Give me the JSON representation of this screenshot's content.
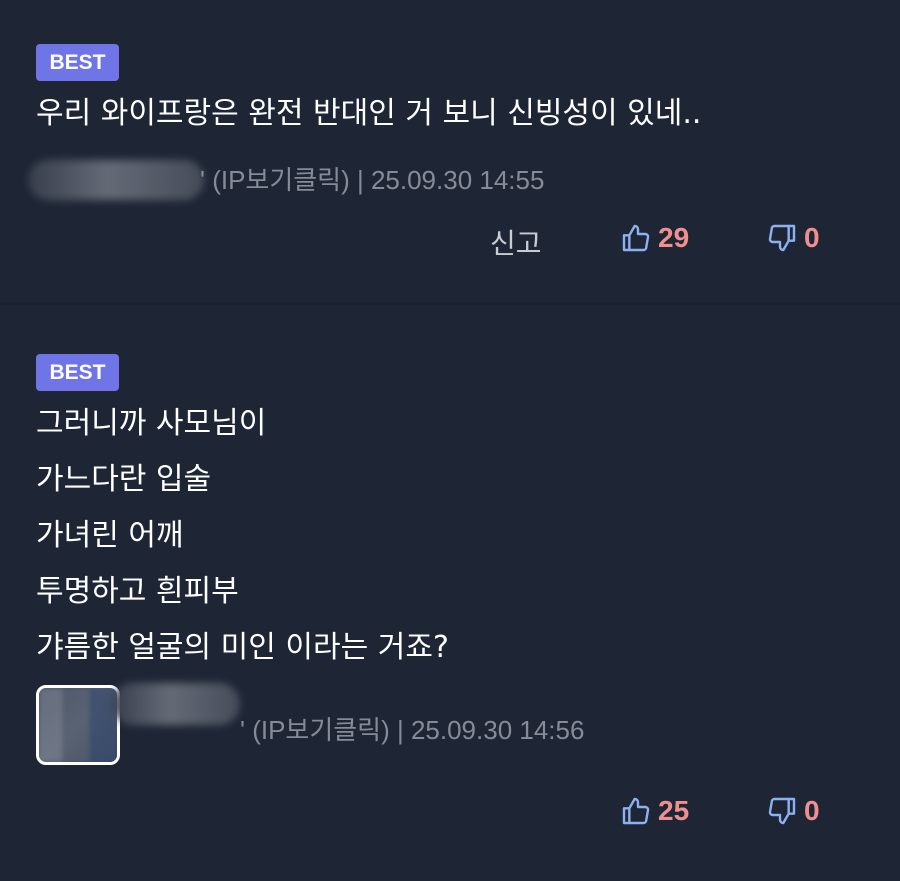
{
  "comments": [
    {
      "badge": "BEST",
      "lines": [
        "우리 와이프랑은 완전 반대인 거 보니 신빙성이 있네.."
      ],
      "meta": "' (IP보기클릭) | 25.09.30 14:55",
      "report_label": "신고",
      "likes": "29",
      "dislikes": "0",
      "icons": {
        "like": "thumbs-up-icon",
        "dislike": "thumbs-down-icon"
      }
    },
    {
      "badge": "BEST",
      "lines": [
        "그러니까 사모님이",
        "가느다란 입술",
        "가녀린 어깨",
        "투명하고 흰피부",
        "갸름한 얼굴의 미인 이라는 거죠?"
      ],
      "meta": "' (IP보기클릭) | 25.09.30 14:56",
      "likes": "25",
      "dislikes": "0",
      "icons": {
        "like": "thumbs-up-icon",
        "dislike": "thumbs-down-icon"
      }
    }
  ],
  "colors": {
    "background": "#1e2636",
    "badge": "#6f74e6",
    "vote_count": "#ef8f8f",
    "icon": "#8fb0f0",
    "meta": "#858b97"
  }
}
